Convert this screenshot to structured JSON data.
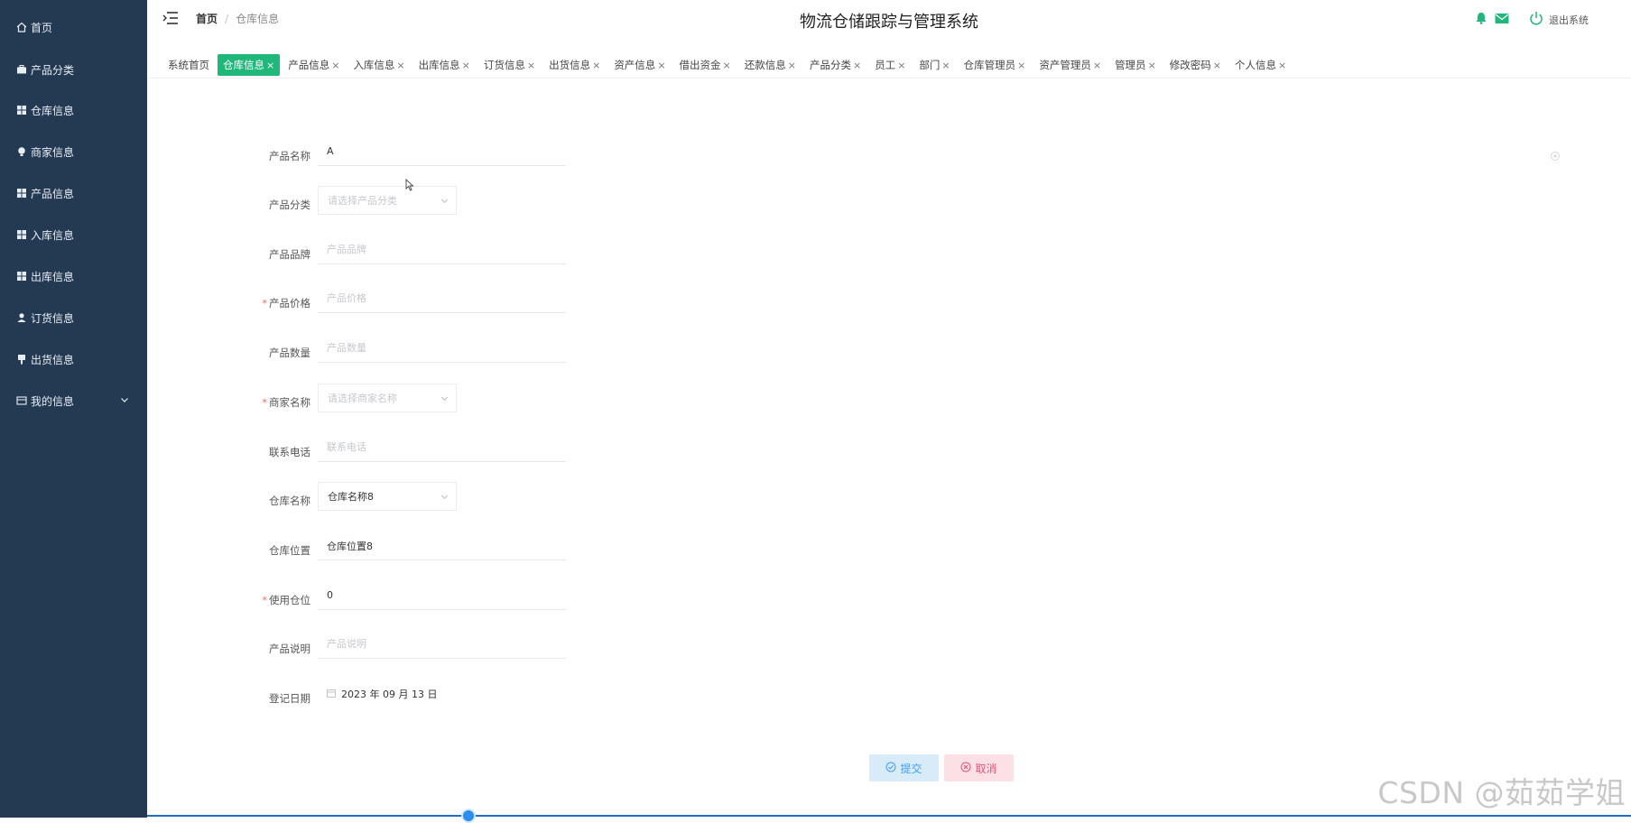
{
  "sidebar": {
    "items": [
      {
        "label": "首页",
        "icon": "home-icon"
      },
      {
        "label": "产品分类",
        "icon": "briefcase-icon"
      },
      {
        "label": "仓库信息",
        "icon": "grid-icon"
      },
      {
        "label": "商家信息",
        "icon": "bulb-icon"
      },
      {
        "label": "产品信息",
        "icon": "grid-icon"
      },
      {
        "label": "入库信息",
        "icon": "grid-icon"
      },
      {
        "label": "出库信息",
        "icon": "grid-icon"
      },
      {
        "label": "订货信息",
        "icon": "user-icon"
      },
      {
        "label": "出货信息",
        "icon": "flag-icon"
      },
      {
        "label": "我的信息",
        "icon": "card-icon"
      }
    ]
  },
  "header": {
    "breadcrumb_home": "首页",
    "breadcrumb_sep": "/",
    "breadcrumb_current": "仓库信息",
    "title": "物流仓储跟踪与管理系统",
    "logout_label": "退出系统"
  },
  "tabs": [
    {
      "label": "系统首页",
      "closable": false,
      "active": false
    },
    {
      "label": "仓库信息",
      "closable": true,
      "active": true
    },
    {
      "label": "产品信息",
      "closable": true,
      "active": false
    },
    {
      "label": "入库信息",
      "closable": true,
      "active": false
    },
    {
      "label": "出库信息",
      "closable": true,
      "active": false
    },
    {
      "label": "订货信息",
      "closable": true,
      "active": false
    },
    {
      "label": "出货信息",
      "closable": true,
      "active": false
    },
    {
      "label": "资产信息",
      "closable": true,
      "active": false
    },
    {
      "label": "借出资金",
      "closable": true,
      "active": false
    },
    {
      "label": "还款信息",
      "closable": true,
      "active": false
    },
    {
      "label": "产品分类",
      "closable": true,
      "active": false
    },
    {
      "label": "员工",
      "closable": true,
      "active": false
    },
    {
      "label": "部门",
      "closable": true,
      "active": false
    },
    {
      "label": "仓库管理员",
      "closable": true,
      "active": false
    },
    {
      "label": "资产管理员",
      "closable": true,
      "active": false
    },
    {
      "label": "管理员",
      "closable": true,
      "active": false
    },
    {
      "label": "修改密码",
      "closable": true,
      "active": false
    },
    {
      "label": "个人信息",
      "closable": true,
      "active": false
    }
  ],
  "tab_close_glyph": "×",
  "form": {
    "product_name": {
      "label": "产品名称",
      "value": "A",
      "required": false
    },
    "product_category": {
      "label": "产品分类",
      "placeholder": "请选择产品分类",
      "required": false
    },
    "product_brand": {
      "label": "产品品牌",
      "placeholder": "产品品牌",
      "required": false
    },
    "product_price": {
      "label": "产品价格",
      "placeholder": "产品价格",
      "required": true
    },
    "product_quantity": {
      "label": "产品数量",
      "placeholder": "产品数量",
      "required": false
    },
    "merchant_name": {
      "label": "商家名称",
      "placeholder": "请选择商家名称",
      "required": true
    },
    "phone": {
      "label": "联系电话",
      "placeholder": "联系电话",
      "required": false
    },
    "warehouse_name": {
      "label": "仓库名称",
      "value": "仓库名称8",
      "required": false
    },
    "warehouse_location": {
      "label": "仓库位置",
      "value": "仓库位置8",
      "required": false
    },
    "used_slots": {
      "label": "使用仓位",
      "value": "0",
      "required": true
    },
    "description": {
      "label": "产品说明",
      "placeholder": "产品说明",
      "required": false
    },
    "register_date": {
      "label": "登记日期",
      "value": "2023 年 09 月 13 日",
      "required": false
    }
  },
  "required_mark": "*",
  "buttons": {
    "submit": "提交",
    "cancel": "取消"
  },
  "watermark": "CSDN @茹茹学姐",
  "colors": {
    "sidebar_bg": "#243a52",
    "active_tab": "#1fb87a",
    "submit": "#409eff",
    "cancel": "#e4547a",
    "required": "#f56c6c"
  }
}
